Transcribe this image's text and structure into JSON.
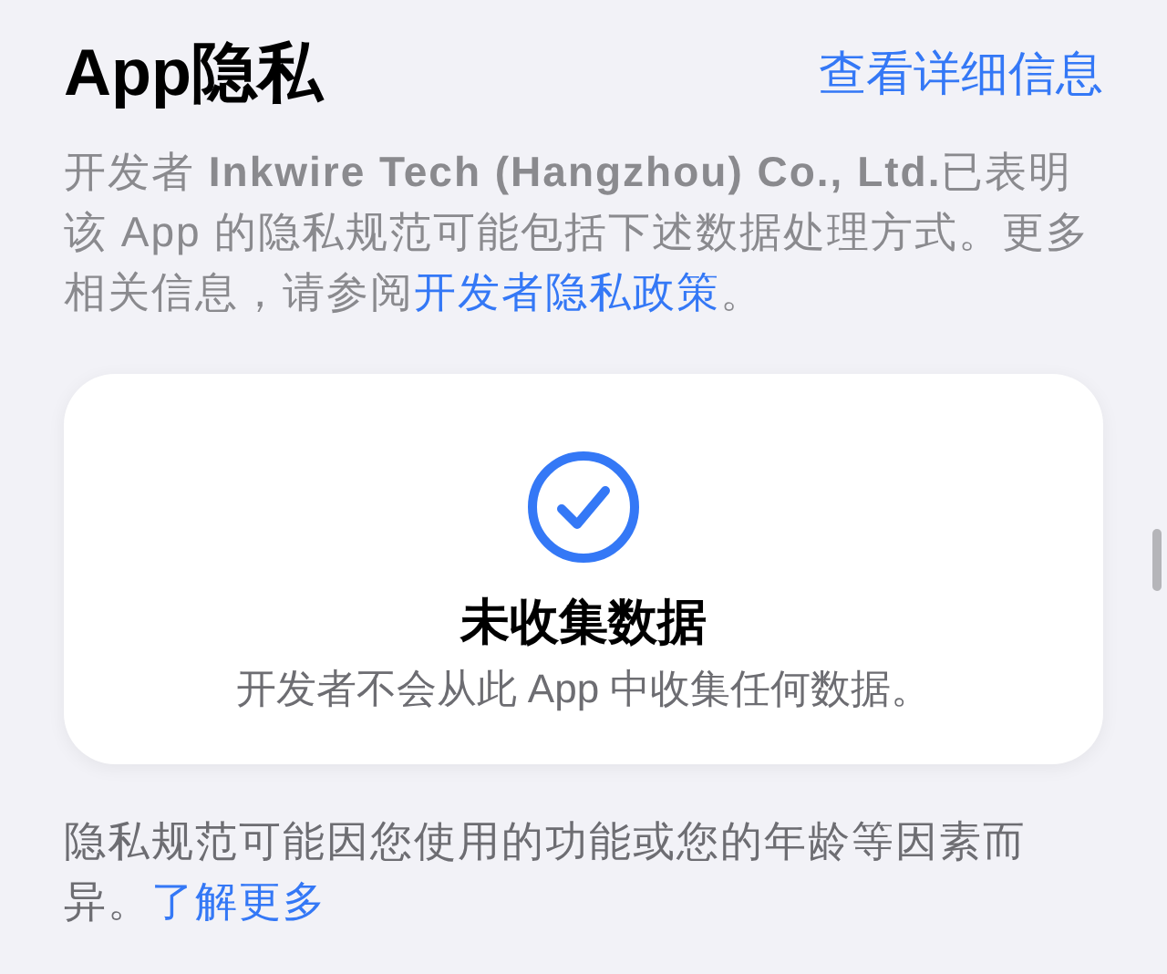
{
  "header": {
    "title": "App隐私",
    "link": "查看详细信息"
  },
  "intro": {
    "text": "开发者 **Inkwire Tech (Hangzhou) Co., Ltd.**已表明该 App 的隐私规范可能包括下述数据处理方式。更多相关信息，请参阅",
    "link": "开发者隐私政策",
    "after": "。"
  },
  "card": {
    "title": "未收集数据",
    "subtitle": "开发者不会从此 App 中收集任何数据。"
  },
  "footer": {
    "text": "隐私规范可能因您使用的功能或您的年龄等因素而异。",
    "link": "了解更多"
  }
}
